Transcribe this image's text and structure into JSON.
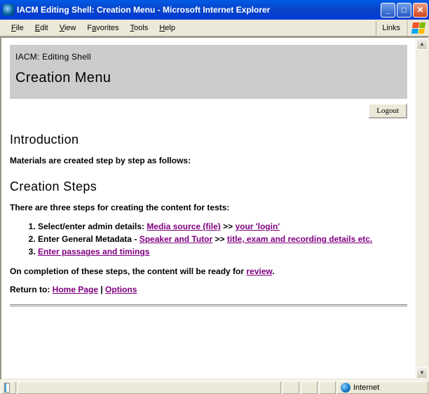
{
  "window": {
    "title": "IACM Editing Shell: Creation Menu - Microsoft Internet Explorer"
  },
  "menubar": {
    "file": "File",
    "edit": "Edit",
    "view": "View",
    "favorites": "Favorites",
    "tools": "Tools",
    "help": "Help",
    "links": "Links"
  },
  "page": {
    "header_sub": "IACM: Editing Shell",
    "header_title": "Creation Menu",
    "logout_label": "Logout",
    "intro_heading": "Introduction",
    "intro_text": "Materials are created step by step as follows:",
    "steps_heading": "Creation Steps",
    "steps_intro": "There are three steps for creating the content for tests:",
    "step1_pre": "Select/enter admin details: ",
    "step1_link1": "Media source (file)",
    "step1_sep": " >> ",
    "step1_link2": "your 'login'",
    "step2_pre": "Enter General Metadata - ",
    "step2_link1": "Speaker and Tutor",
    "step2_sep": " >> ",
    "step2_link2": "title, exam and recording details etc.",
    "step3_link": "Enter passages and timings",
    "completion_pre": "On completion of these steps, the content will be ready for ",
    "completion_link": "review",
    "completion_post": ".",
    "return_pre": "Return to: ",
    "return_link1": "Home Page",
    "return_sep": " | ",
    "return_link2": "Options"
  },
  "statusbar": {
    "zone": "Internet"
  }
}
